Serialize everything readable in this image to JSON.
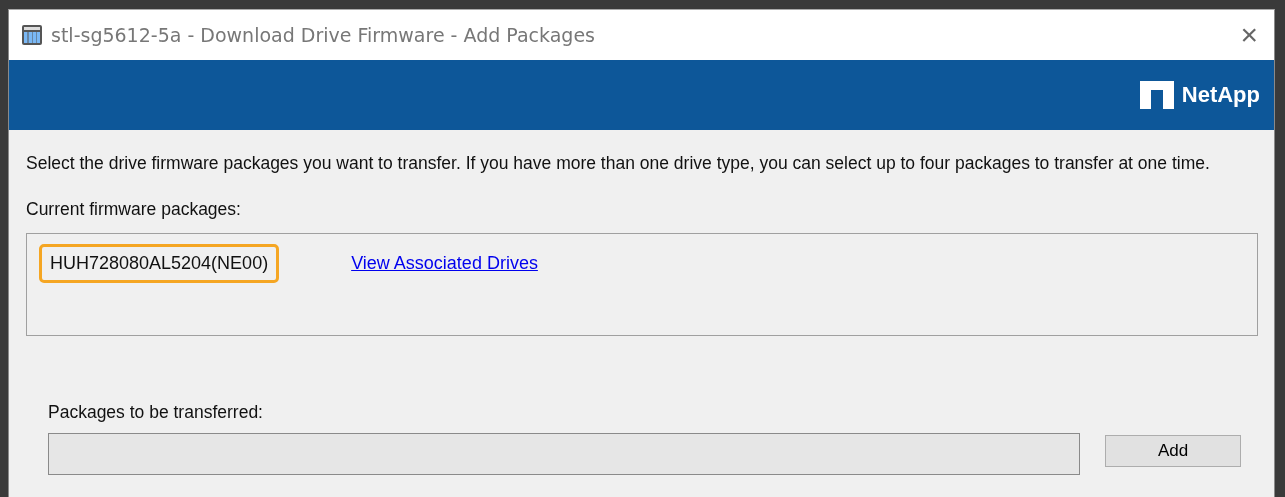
{
  "window": {
    "title": "stl-sg5612-5a - Download Drive Firmware - Add Packages",
    "close": "×"
  },
  "banner": {
    "brand": "NetApp"
  },
  "instructions": "Select the drive firmware packages you want to transfer. If you have more than one drive type, you can select up to four packages to transfer at one time.",
  "current": {
    "label": "Current firmware packages:",
    "packages": [
      {
        "name": "HUH728080AL5204(NE00)",
        "highlighted": true,
        "link": "View Associated Drives"
      }
    ]
  },
  "transfer": {
    "label": "Packages to be transferred:",
    "add_button": "Add"
  }
}
